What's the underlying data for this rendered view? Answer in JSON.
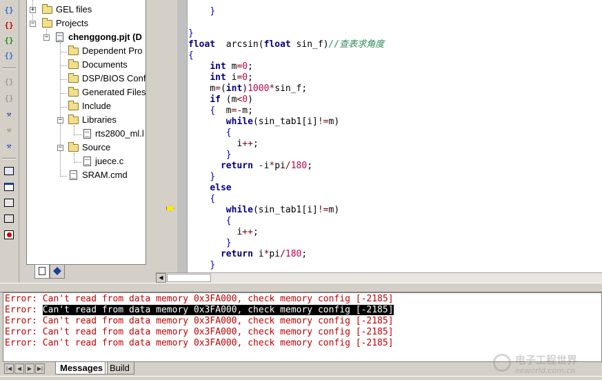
{
  "toolbar": {
    "icons": [
      "braces-icon",
      "braces-red-icon",
      "braces-run-icon",
      "braces-step-icon",
      "step-into-icon",
      "step-over-icon",
      "run-icon",
      "run-cursor-icon",
      "animate-icon",
      "watch-icon",
      "memory-icon",
      "registers-icon",
      "disassembly-icon",
      "breakpoint-icon"
    ]
  },
  "tree": {
    "items": [
      {
        "label": "GEL files",
        "kind": "folder"
      },
      {
        "label": "Projects",
        "kind": "folder"
      },
      {
        "label": "chenggong.pjt (D",
        "kind": "project"
      },
      {
        "label": "Dependent Pro",
        "kind": "folder"
      },
      {
        "label": "Documents",
        "kind": "folder"
      },
      {
        "label": "DSP/BIOS Conf",
        "kind": "folder"
      },
      {
        "label": "Generated Files",
        "kind": "folder"
      },
      {
        "label": "Include",
        "kind": "folder"
      },
      {
        "label": "Libraries",
        "kind": "folder"
      },
      {
        "label": "rts2800_ml.l",
        "kind": "file"
      },
      {
        "label": "Source",
        "kind": "folder"
      },
      {
        "label": "juece.c",
        "kind": "file"
      },
      {
        "label": "SRAM.cmd",
        "kind": "file"
      }
    ],
    "tabs": [
      "file-view-tab",
      "bookmarks-tab"
    ]
  },
  "editor": {
    "lines": [
      {
        "t": "    }"
      },
      {
        "t": ""
      },
      {
        "t": "}"
      },
      {
        "t": "float  arcsin(float sin_f)",
        "c": "//查表求角度"
      },
      {
        "t": "{"
      },
      {
        "t": "    int m=0;"
      },
      {
        "t": "    int i=0;"
      },
      {
        "t": "    m=(int)1000*sin_f;"
      },
      {
        "t": "    if (m<0)"
      },
      {
        "t": "    {  m=-m;"
      },
      {
        "t": "       while(sin_tab1[i]!=m)"
      },
      {
        "t": "       {"
      },
      {
        "t": "         i++;"
      },
      {
        "t": "       }"
      },
      {
        "t": "      return -i*pi/180;"
      },
      {
        "t": "    }"
      },
      {
        "t": "    else"
      },
      {
        "t": "    {"
      },
      {
        "t": "       while(sin_tab1[i]!=m)"
      },
      {
        "t": "       {"
      },
      {
        "t": "         i++;"
      },
      {
        "t": "       }"
      },
      {
        "t": "      return i*pi/180;"
      },
      {
        "t": "    }"
      }
    ],
    "pc_line": 18
  },
  "output": {
    "lines": [
      {
        "prefix": "Error: ",
        "msg": "Can't read from data memory 0x3FA000, check memory config [-2185]",
        "selected": false
      },
      {
        "prefix": "Error: ",
        "msg": "Can't read from data memory 0x3FA000, check memory config [-2185]",
        "selected": true
      },
      {
        "prefix": "Error: ",
        "msg": "Can't read from data memory 0x3FA000, check memory config [-2185]",
        "selected": false
      },
      {
        "prefix": "Error: ",
        "msg": "Can't read from data memory 0x3FA000, check memory config [-2185]",
        "selected": false
      },
      {
        "prefix": "Error: ",
        "msg": "Can't read from data memory 0x3FA000, check memory config [-2185]",
        "selected": false
      }
    ],
    "tabs": [
      "Messages",
      "Build"
    ],
    "active_tab": "Messages"
  },
  "watermark": {
    "text": "电子工程世界",
    "sub": "eeworld.com.cn"
  },
  "colors": {
    "error": "#c00000",
    "keyword": "#00007f",
    "number": "#c2004a",
    "comment": "#2e8b57"
  }
}
